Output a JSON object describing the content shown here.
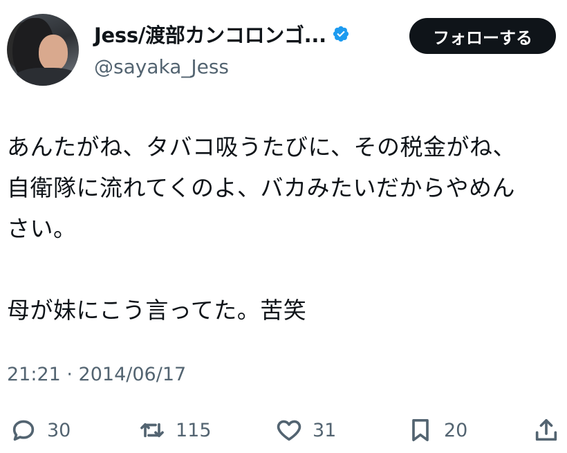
{
  "author": {
    "display_name": "Jess/渡部カンコロンゴ...",
    "handle": "@sayaka_Jess",
    "verified": true,
    "verified_color": "#1d9bf0"
  },
  "follow_button": {
    "label": "フォローする"
  },
  "tweet": {
    "lines": [
      "あんたがね、タバコ吸うたびに、その税金がね、",
      "自衛隊に流れてくのよ、バカみたいだからやめん",
      "さい。",
      "母が妹にこう言ってた。苦笑"
    ],
    "timestamp": "21:21 · 2014/06/17"
  },
  "actions": {
    "reply": {
      "icon": "reply-bubble-icon",
      "count": "30"
    },
    "retweet": {
      "icon": "retweet-icon",
      "count": "115"
    },
    "like": {
      "icon": "heart-icon",
      "count": "31"
    },
    "bookmark": {
      "icon": "bookmark-icon",
      "count": "20"
    },
    "share": {
      "icon": "share-icon"
    }
  }
}
